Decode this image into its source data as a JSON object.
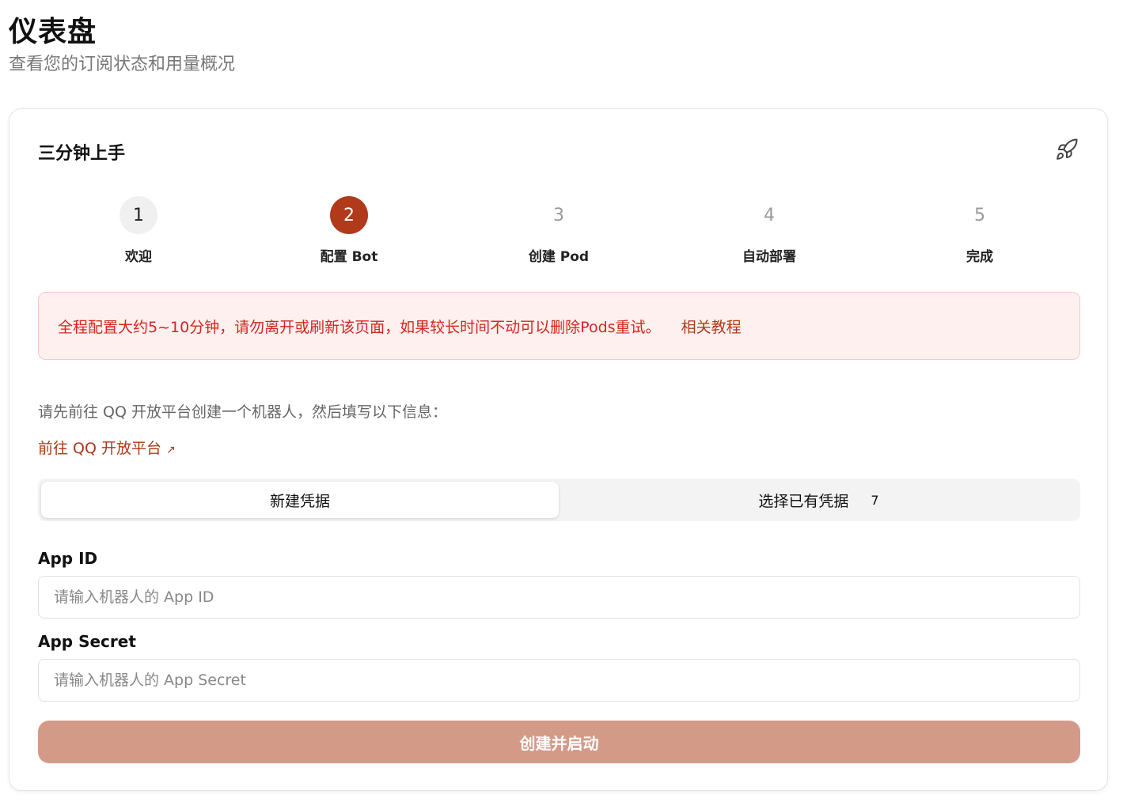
{
  "page": {
    "title": "仪表盘",
    "subtitle": "查看您的订阅状态和用量概况"
  },
  "card": {
    "title": "三分钟上手",
    "icon": "rocket-icon"
  },
  "steps": [
    {
      "number": "1",
      "label": "欢迎",
      "state": "done"
    },
    {
      "number": "2",
      "label": "配置 Bot",
      "state": "active"
    },
    {
      "number": "3",
      "label": "创建 Pod",
      "state": "pending"
    },
    {
      "number": "4",
      "label": "自动部署",
      "state": "pending"
    },
    {
      "number": "5",
      "label": "完成",
      "state": "pending"
    }
  ],
  "alert": {
    "text": "全程配置大约5~10分钟，请勿离开或刷新该页面，如果较长时间不动可以删除Pods重试。",
    "link": "相关教程"
  },
  "intro": "请先前往 QQ 开放平台创建一个机器人，然后填写以下信息：",
  "external_link": {
    "label": "前往 QQ 开放平台",
    "arrow": "↗"
  },
  "tabs": {
    "new": "新建凭据",
    "existing": "选择已有凭据",
    "existing_count": "7"
  },
  "form": {
    "app_id_label": "App ID",
    "app_id_placeholder": "请输入机器人的 App ID",
    "app_secret_label": "App Secret",
    "app_secret_placeholder": "请输入机器人的 App Secret",
    "submit": "创建并启动"
  },
  "colors": {
    "accent": "#b03a1a",
    "alert_text": "#d4261f",
    "alert_bg": "#fff0f0",
    "submit_disabled": "#d49a88"
  }
}
